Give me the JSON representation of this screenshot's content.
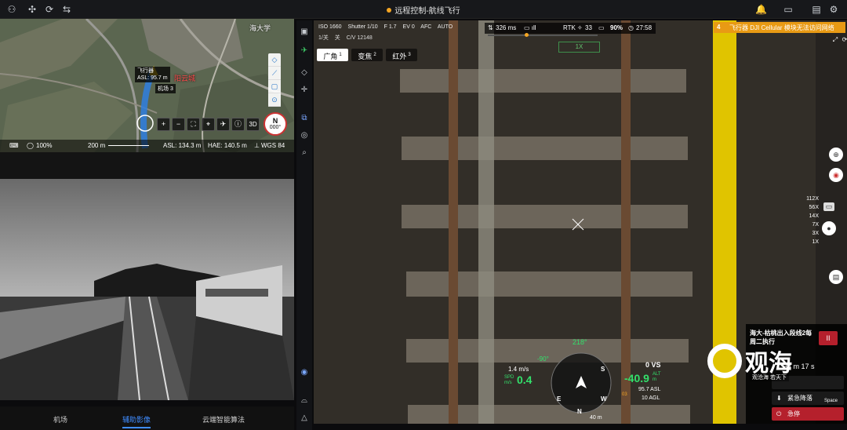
{
  "topbar": {
    "title": "远程控制-航线飞行",
    "left_icons": [
      "topology-icon",
      "drone-icon",
      "sync-icon",
      "swap-icon"
    ],
    "right_icons": [
      "bell-icon",
      "layout-icon",
      "message-icon",
      "settings-icon"
    ]
  },
  "map": {
    "place_label": "海大学",
    "district_label": "阳云城",
    "aircraft": {
      "label": "飞行器",
      "asl": "ASL: 95.7 m"
    },
    "dock_label": "机场 3",
    "zoom_percent": "100%",
    "scale": "200 m",
    "asl": "ASL: 134.3 m",
    "hae": "HAE: 140.5 m",
    "datum": "WGS 84",
    "tools": [
      "+",
      "−",
      "⛶",
      "⌖",
      "✈",
      "ⓘ",
      "3D"
    ],
    "compass": {
      "dir": "N",
      "deg": "000°"
    },
    "vertical_tools": [
      "◇",
      "⟋",
      "▢",
      "⊙"
    ]
  },
  "bottom_tabs": [
    {
      "label": "机场"
    },
    {
      "label": "辅助影像",
      "active": true
    },
    {
      "label": "云端智能算法"
    }
  ],
  "camera": {
    "iso": "ISO 1660",
    "shutter": "Shutter 1/10",
    "fstop": "F 1.7",
    "ev": "EV 0",
    "af": "AFC",
    "mode": "AUTO",
    "line2": [
      "1/关",
      "关",
      "C/V 12148"
    ],
    "tabs": [
      {
        "label": "广角",
        "num": "1",
        "active": true
      },
      {
        "label": "变焦",
        "num": "2"
      },
      {
        "label": "红外",
        "num": "3"
      }
    ]
  },
  "status": {
    "latency": "326 ms",
    "rtk_label": "RTK",
    "rtk_count": "33",
    "battery": "90%",
    "flight_time": "27:58"
  },
  "zoom_indicator": "1X",
  "alert": {
    "index": "4",
    "text": "飞行器 DJI Cellular 模块无法访问网络"
  },
  "zoom_levels": [
    "112X",
    "56X",
    "14X",
    "7X",
    "3X",
    "1X"
  ],
  "hud": {
    "heading": "218°",
    "gimbal": "-90°",
    "vspeed_small": "1.4 m/s",
    "speed_label": "SPD",
    "speed_unit": "m/s",
    "speed": "0.4",
    "vs": "0 VS",
    "alt": "-40.9",
    "alt_label": "ALT",
    "alt_unit": "m",
    "asl": "95.7 ASL",
    "agl": "10 AGL",
    "dist": "40 m",
    "compass_marks": [
      "S",
      "W",
      "E",
      "N"
    ],
    "compass_small": "03"
  },
  "mission": {
    "title": "海大-枯桃出入段线2每周二执行",
    "remaining": "34 m 17 s",
    "pause": "II",
    "return_label": "紧急降落",
    "stop_label": "急停",
    "shortcut": "Space"
  },
  "watermark": {
    "name": "观海",
    "slogan": "观沧海 若天下"
  },
  "colors": {
    "accent": "#3f8cff",
    "alert": "#e89a14",
    "danger": "#b5202c",
    "hud_green": "#33e06b"
  }
}
